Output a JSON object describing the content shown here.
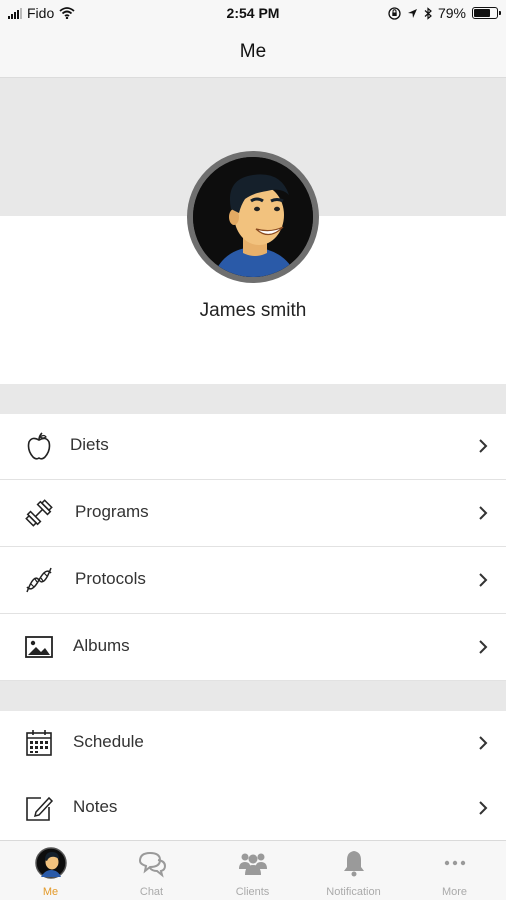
{
  "status_bar": {
    "carrier": "Fido",
    "time": "2:54 PM",
    "battery": "79%",
    "battery_level": 0.79,
    "icons": [
      "signal-icon",
      "wifi-icon",
      "lock-rotation-icon",
      "location-icon",
      "bluetooth-icon",
      "battery-icon"
    ]
  },
  "nav": {
    "title": "Me"
  },
  "profile": {
    "name": "James smith"
  },
  "menu": {
    "group1": [
      {
        "label": "Diets",
        "icon": "apple-icon"
      },
      {
        "label": "Programs",
        "icon": "dumbbell-icon"
      },
      {
        "label": "Protocols",
        "icon": "dna-icon"
      },
      {
        "label": "Albums",
        "icon": "image-icon"
      }
    ],
    "group2": [
      {
        "label": "Schedule",
        "icon": "calendar-icon"
      },
      {
        "label": "Notes",
        "icon": "notes-icon"
      }
    ]
  },
  "tabbar": {
    "items": [
      {
        "label": "Me",
        "icon": "avatar-icon",
        "active": true
      },
      {
        "label": "Chat",
        "icon": "chat-icon",
        "active": false
      },
      {
        "label": "Clients",
        "icon": "clients-icon",
        "active": false
      },
      {
        "label": "Notification",
        "icon": "bell-icon",
        "active": false
      },
      {
        "label": "More",
        "icon": "more-icon",
        "active": false
      }
    ]
  },
  "colors": {
    "accent": "#e39a2a",
    "inactive_tab": "#aaaaaa",
    "separator": "#e8e8e8",
    "bar_background": "#f7f7f7"
  }
}
